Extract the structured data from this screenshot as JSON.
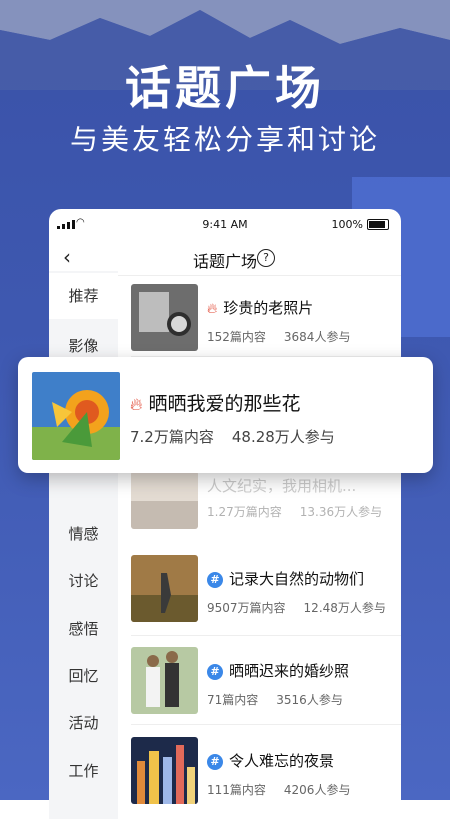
{
  "hero": {
    "title": "话题广场",
    "subtitle": "与美友轻松分享和讨论"
  },
  "status_bar": {
    "time": "9:41 AM",
    "battery": "100%"
  },
  "nav": {
    "back_icon": "back-chevron-icon",
    "title": "话题广场",
    "help": "?"
  },
  "sidebar": {
    "items": [
      {
        "label": "推荐",
        "active": true
      },
      {
        "label": "影像"
      },
      {
        "label": "情感"
      },
      {
        "label": "讨论"
      },
      {
        "label": "感悟"
      },
      {
        "label": "回忆"
      },
      {
        "label": "活动"
      },
      {
        "label": "工作"
      }
    ]
  },
  "topics": [
    {
      "icon": "fire-icon",
      "title": "珍贵的老照片",
      "posts": "152篇内容",
      "participants": "3684人参与"
    },
    {
      "icon": "hashtag-icon",
      "title": "记录大自然的动物们",
      "posts": "9507万篇内容",
      "participants": "12.48万人参与"
    },
    {
      "icon": "hashtag-icon",
      "title": "晒晒迟来的婚纱照",
      "posts": "71篇内容",
      "participants": "3516人参与"
    },
    {
      "icon": "hashtag-icon",
      "title": "令人难忘的夜景",
      "posts": "111篇内容",
      "participants": "4206人参与"
    }
  ],
  "partially_hidden_row": {
    "title": "人文纪实，我用相机...",
    "posts": "1.27万篇内容",
    "participants": "13.36万人参与"
  },
  "featured_card": {
    "icon": "fire-icon",
    "title": "晒晒我爱的那些花",
    "posts": "7.2万篇内容",
    "participants": "48.28万人参与"
  },
  "colors": {
    "background": "#3e58b0",
    "fire": "#e0432f",
    "hashtag": "#3b88e8"
  }
}
